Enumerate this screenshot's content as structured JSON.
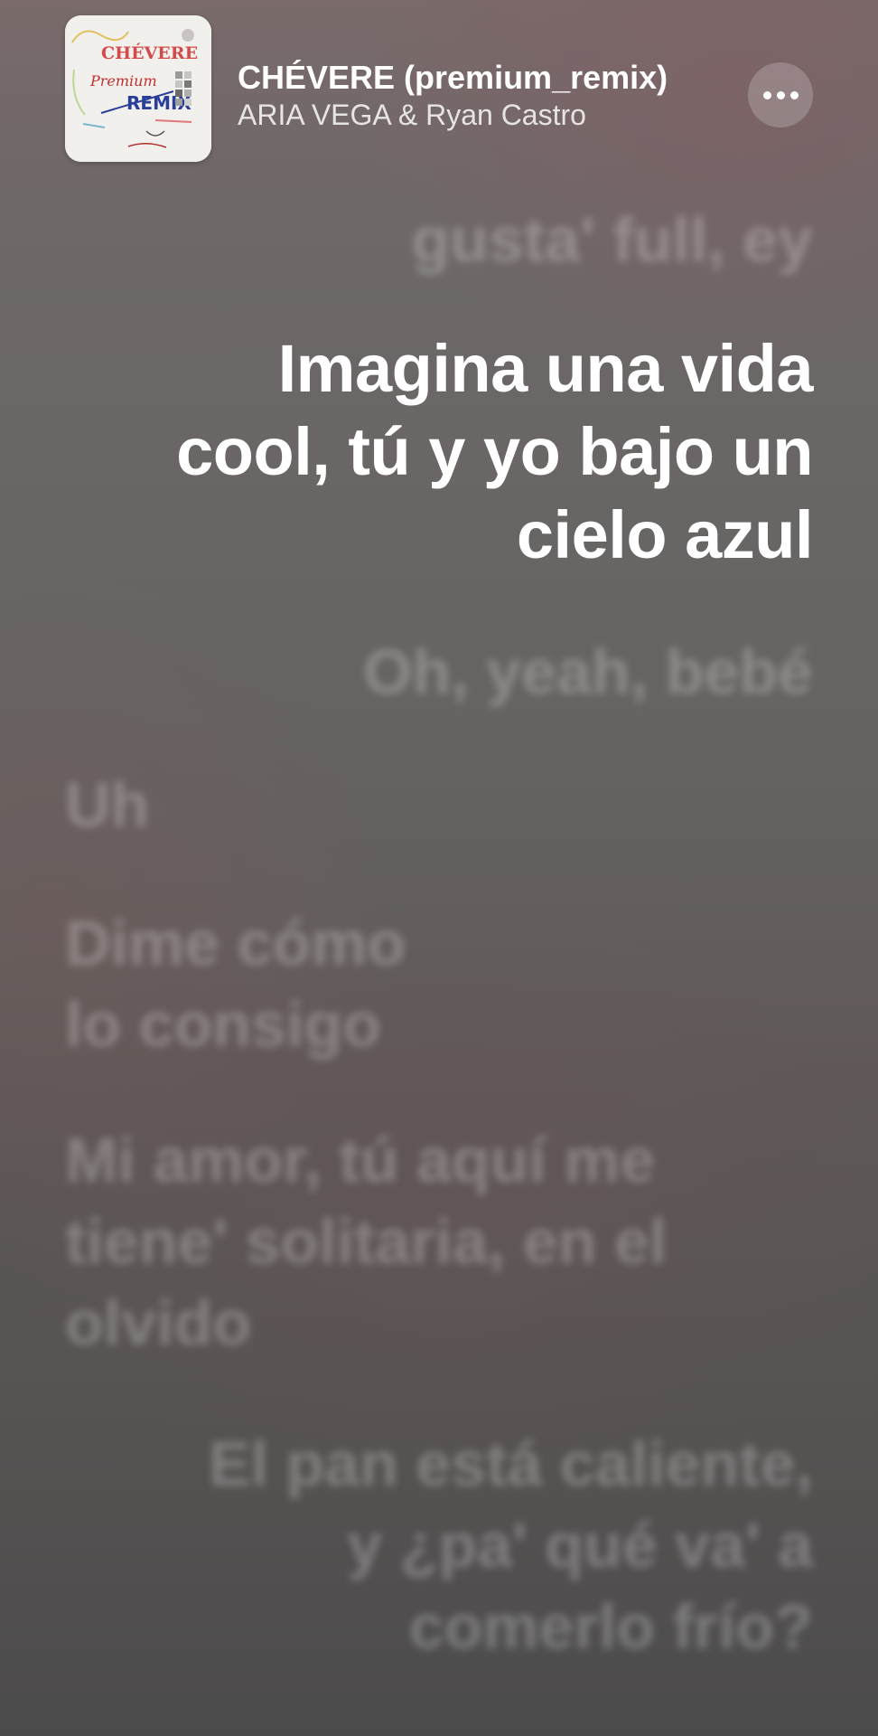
{
  "now_playing": {
    "title": "CHÉVERE (premium_remix)",
    "artist": "ARIA VEGA & Ryan Castro",
    "more_icon": "ellipsis-horizontal-icon"
  },
  "album_art": {
    "text_chevere": "CHÉVERE",
    "text_premium": "Premium",
    "text_remix": "REMIX"
  },
  "lyrics": {
    "previous": "gusta' full, ey",
    "current": [
      "Imagina una vida",
      "cool, tú y yo bajo un",
      "cielo azul"
    ],
    "next_1": "Oh, yeah, bebé",
    "next_2": "Uh",
    "next_3": [
      "Dime cómo",
      "lo consigo"
    ],
    "next_4": [
      "Mi amor, tú aquí me",
      "tiene' solitaria, en el",
      "olvido"
    ],
    "next_5": [
      "El pan está caliente,",
      "y ¿pa' qué va' a",
      "comerlo frío?"
    ]
  },
  "colors": {
    "background_top": "#7a6a6a",
    "background_bottom": "#4c4b4b",
    "active_lyric": "#ffffff",
    "inactive_lyric": "rgba(255,255,255,0.26)"
  }
}
